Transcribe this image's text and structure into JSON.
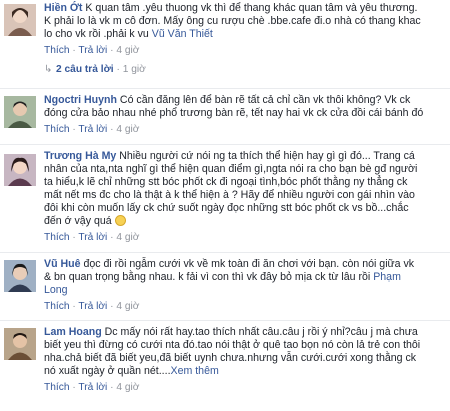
{
  "actions": {
    "like": "Thích",
    "reply": "Trả lời",
    "sep": " · "
  },
  "comments": [
    {
      "author": "Hiền Ớt",
      "lines": [
        " K quan tâm .yêu thuong vk thì để thang khác quan tâm và yêu thương.",
        "K phải lo là vk m cô đơn. Mấy ông cu rượu chè .bbe.cafe đi.o nhà có thang khac",
        "lo cho vk rồi .phải k vu "
      ],
      "mention": "Vũ Văn Thiết",
      "time": "4 giờ",
      "replies": {
        "label": "2 câu trả lời",
        "time": " · 1 giờ"
      }
    },
    {
      "author": "Ngoctri Huynh",
      "lines": [
        " Có cần đăng lên để bàn rẽ tất cả chỉ cần vk thôi không? Vk ck",
        "đóng cửa bảo nhau nhé phổ trương bàn rẽ, tết nay hai vk ck cửa đồi cái bánh đó"
      ],
      "time": "4 giờ"
    },
    {
      "author": "Trương Hà My",
      "lines": [
        " Nhiều người cứ nói ng ta thích thể hiện hay gì gì đó... Trang cá",
        "nhân của nta,nta nghĩ gì thể hiện quan điểm gì,ngta nói ra cho bạn bè gđ người",
        "ta hiểu,k lẽ chỉ những stt bóc phốt ck đi ngoại tình,bóc phốt thằng ny thẳng ck",
        "mất nết ms đc cho là thật à k thể hiện à ? Hãy để nhiều người con gái nhìn vào",
        "đôi khi còn muốn lấy ck chứ suốt ngày đọc những stt bóc phốt ck vs bồ...chắc",
        "đến ớ vậy quá "
      ],
      "time": "4 giờ"
    },
    {
      "author": "Vũ Huê",
      "lines": [
        " đọc đi rồi ngẫm cưới vk về mk toàn đi ăn chơi với bạn. còn nói giữa vk",
        "& bn quan trọng bằng nhau. k fải vì con thì vk đây bỏ mịa ck từ lâu rồi "
      ],
      "mention": "Phạm",
      "extra_line": "Long",
      "time": "4 giờ"
    },
    {
      "author": "Lam Hoang",
      "lines": [
        " Dc mấy nói rất hay.tao thích nhất câu.câu j rồi ý nhỉ?câu j mà chưa",
        "biết yeu thì đừng có cưới nta đó.tao nói thật ở quê tao bọn nó còn lả trẻ con thôi",
        "nha.chả biết đã biết yeu,đã biết uynh chưa.nhưng vẫn cưới.cưới xong thằng ck",
        "nó xuất ngày ở quần nét...."
      ],
      "see_more": "Xem thêm",
      "time": "4 giờ"
    }
  ]
}
